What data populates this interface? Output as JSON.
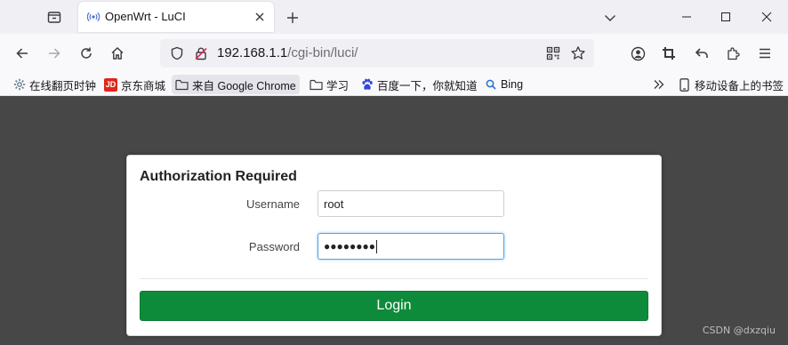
{
  "browser": {
    "tab": {
      "title": "OpenWrt - LuCI",
      "favicon": "radio-waves-icon"
    },
    "url": {
      "host": "192.168.1.1",
      "path": "/cgi-bin/luci/"
    },
    "bookmarks": [
      {
        "label": "在线翻页时钟",
        "icon": "gear-flower-icon"
      },
      {
        "label": "京东商城",
        "icon": "jd-logo-icon"
      },
      {
        "label": "来自 Google Chrome",
        "icon": "folder-icon"
      },
      {
        "label": "学习",
        "icon": "folder-icon"
      },
      {
        "label": "百度一下，你就知道",
        "icon": "baidu-paw-icon"
      },
      {
        "label": "Bing",
        "icon": "search-icon"
      }
    ],
    "mobile_bookmarks": "移动设备上的书签",
    "jd_logo_text": "JD"
  },
  "login": {
    "title": "Authorization Required",
    "username_label": "Username",
    "username_value": "root",
    "password_label": "Password",
    "password_mask": "●●●●●●●●",
    "submit_label": "Login"
  },
  "watermark": "CSDN @dxzqiu",
  "colors": {
    "page_bg": "#474747",
    "login_button": "#0e8a3b",
    "focus_border": "#55a3e6",
    "jd_red": "#e1251b"
  }
}
